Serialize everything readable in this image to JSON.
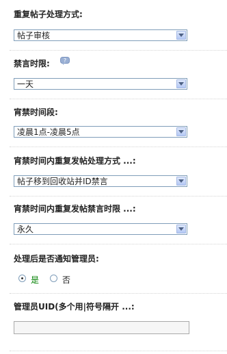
{
  "fields": [
    {
      "label": "重复帖子处理方式:",
      "value": "帖子审核"
    },
    {
      "label": "禁言时限:",
      "value": "一天"
    },
    {
      "label": "宵禁时间段:",
      "value": "凌晨1点-凌晨5点"
    },
    {
      "label": "宵禁时间内重复发帖处理方式 ...:",
      "value": "帖子移到回收站并ID禁言"
    },
    {
      "label": "宵禁时间内重复发帖禁言时限 ...:",
      "value": "永久"
    }
  ],
  "notify": {
    "label": "处理后是否通知管理员:",
    "yes_label": "是",
    "no_label": "否",
    "selected": "yes",
    "yes_color": "#008000"
  },
  "admin_uid": {
    "label": "管理员UID(多个用|符号隔开 ...:",
    "value": ""
  }
}
